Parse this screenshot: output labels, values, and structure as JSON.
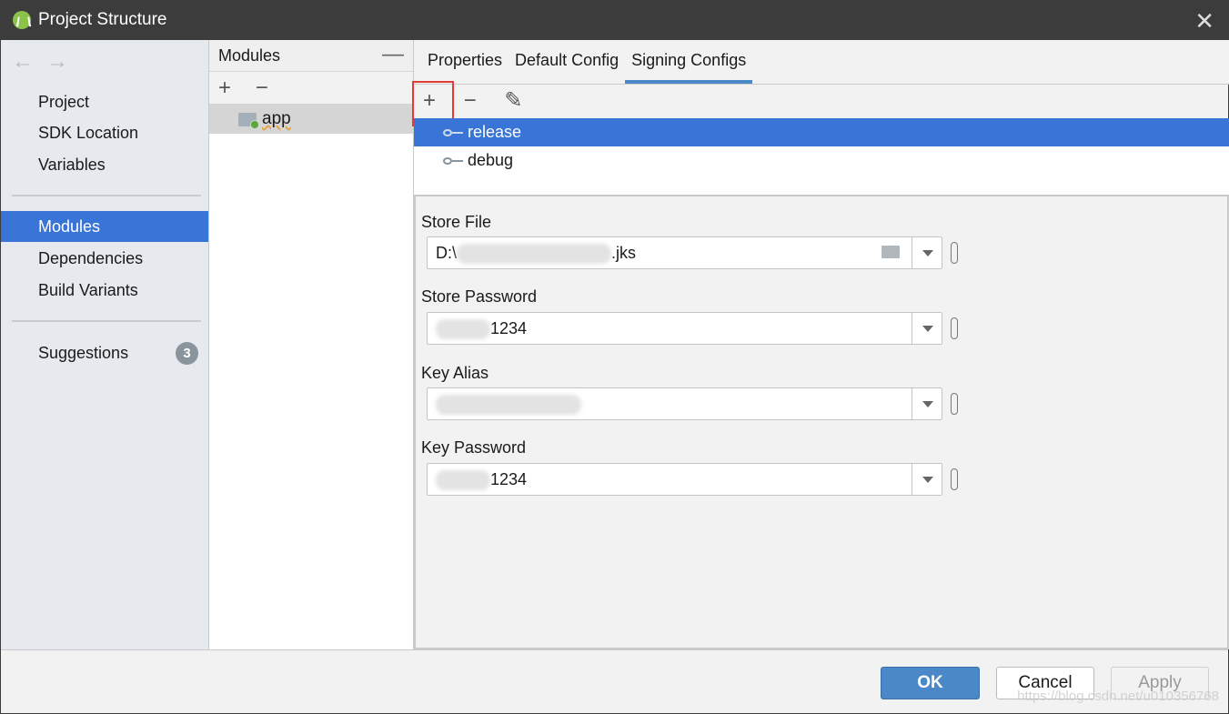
{
  "window": {
    "title": "Project Structure"
  },
  "sidebar": {
    "items": [
      {
        "label": "Project"
      },
      {
        "label": "SDK Location"
      },
      {
        "label": "Variables"
      },
      {
        "label": "Modules"
      },
      {
        "label": "Dependencies"
      },
      {
        "label": "Build Variants"
      },
      {
        "label": "Suggestions",
        "badge": "3"
      }
    ]
  },
  "modules": {
    "header": "Modules",
    "add": "+",
    "remove": "−",
    "items": [
      {
        "label": "app"
      }
    ]
  },
  "tabs": [
    {
      "label": "Properties"
    },
    {
      "label": "Default Config"
    },
    {
      "label": "Signing Configs"
    }
  ],
  "toolbar": {
    "add": "+",
    "remove": "−",
    "edit": "✎"
  },
  "signing_configs": [
    {
      "label": "release"
    },
    {
      "label": "debug"
    }
  ],
  "form": {
    "store_file": {
      "label": "Store File",
      "prefix": "D:\\",
      "suffix": ".jks"
    },
    "store_password": {
      "label": "Store Password",
      "suffix": "1234"
    },
    "key_alias": {
      "label": "Key Alias"
    },
    "key_password": {
      "label": "Key Password",
      "suffix": "1234"
    }
  },
  "buttons": {
    "ok": "OK",
    "cancel": "Cancel",
    "apply": "Apply"
  },
  "watermark": "https://blog.csdn.net/u010356768",
  "colors": {
    "selection": "#3875d7",
    "ok": "#4a88c7",
    "highlight_box": "#e53935"
  }
}
